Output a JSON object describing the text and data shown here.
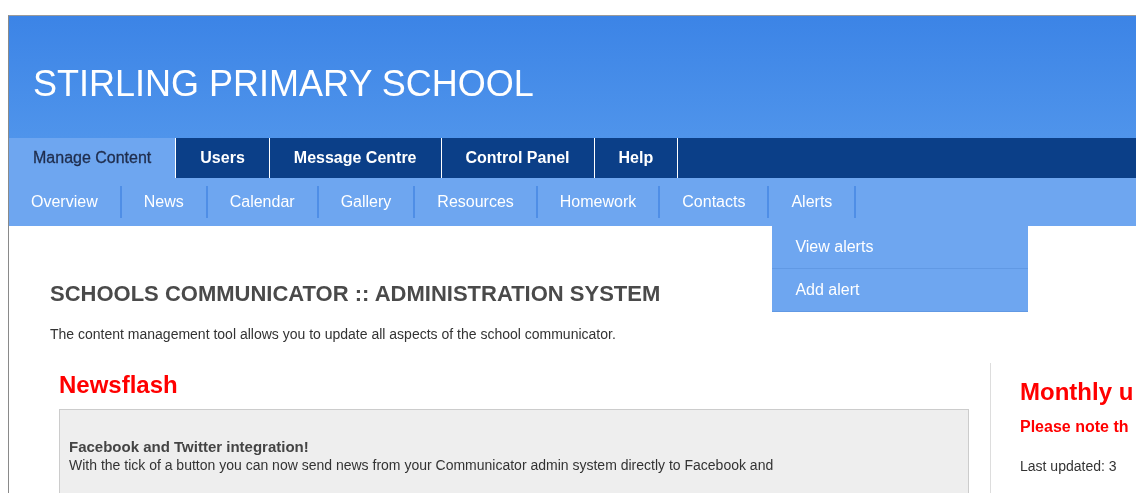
{
  "header": {
    "title": "STIRLING PRIMARY SCHOOL"
  },
  "main_nav": [
    {
      "label": "Manage Content",
      "selected": true
    },
    {
      "label": "Users",
      "selected": false
    },
    {
      "label": "Message Centre",
      "selected": false
    },
    {
      "label": "Control Panel",
      "selected": false
    },
    {
      "label": "Help",
      "selected": false
    }
  ],
  "sub_nav": [
    {
      "label": "Overview"
    },
    {
      "label": "News"
    },
    {
      "label": "Calendar"
    },
    {
      "label": "Gallery"
    },
    {
      "label": "Resources"
    },
    {
      "label": "Homework"
    },
    {
      "label": "Contacts"
    },
    {
      "label": "Alerts",
      "children": [
        {
          "label": "View alerts"
        },
        {
          "label": "Add alert"
        }
      ]
    }
  ],
  "page": {
    "heading": "SCHOOLS COMMUNICATOR :: ADMINISTRATION SYSTEM",
    "intro": "The content management tool allows you to update all aspects of the school communicator."
  },
  "newsflash": {
    "title": "Newsflash",
    "items": [
      {
        "title": "Facebook and Twitter integration!",
        "body": "With the tick of a button you can now send news from your Communicator admin system directly to Facebook and"
      }
    ]
  },
  "monthly": {
    "title": "Monthly u",
    "notice": "Please note th",
    "updated": "Last updated: 3"
  }
}
